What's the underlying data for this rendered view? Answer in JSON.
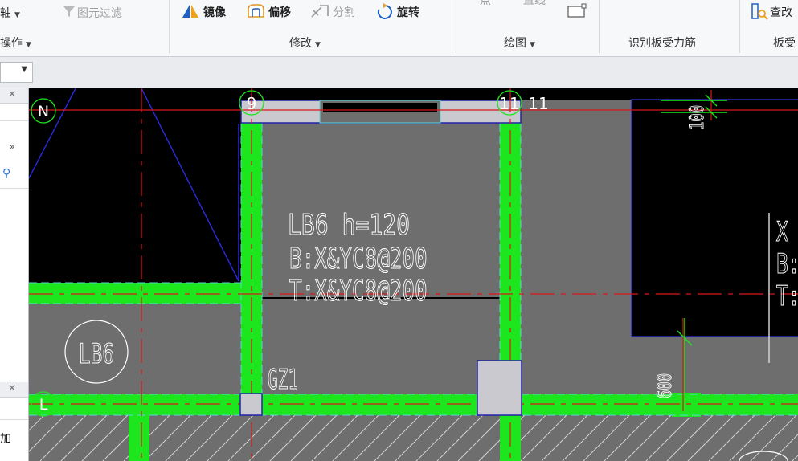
{
  "ribbon": {
    "group1": {
      "item_axis": "轴",
      "item_filter": "图元过滤",
      "title": "操作"
    },
    "modify": {
      "mirror": "镜像",
      "offset": "偏移",
      "split": "分割",
      "rotate": "旋转",
      "title": "修改"
    },
    "draw": {
      "point": "点",
      "line": "直线",
      "title": "绘图"
    },
    "recognize": {
      "title": "识别板受力筋"
    },
    "last": {
      "check": "查改",
      "title": "板受"
    }
  },
  "leftpanel": {
    "text_add": "加"
  },
  "canvas": {
    "axis_n": "N",
    "axis_l": "L",
    "axis_9": "9",
    "axis_11a": "11",
    "axis_11b": "11",
    "slab_line1": "LB6 h=120",
    "slab_line2": "B:X&YC8@200",
    "slab_line3": "T:X&YC8@200",
    "slab_circle": "LB6",
    "column_label": "GZ1",
    "dim_100": "100",
    "dim_600": "600",
    "right_frag1": "X",
    "right_frag2": "B:",
    "right_frag3": "T:"
  },
  "colors": {
    "beam_green": "#1ee61e",
    "axis_red": "#d81818",
    "slab_gray": "#6e6e6e",
    "column_fill": "#c9c9cf",
    "column_edge": "#2323a8",
    "text_white": "#ffffff"
  }
}
